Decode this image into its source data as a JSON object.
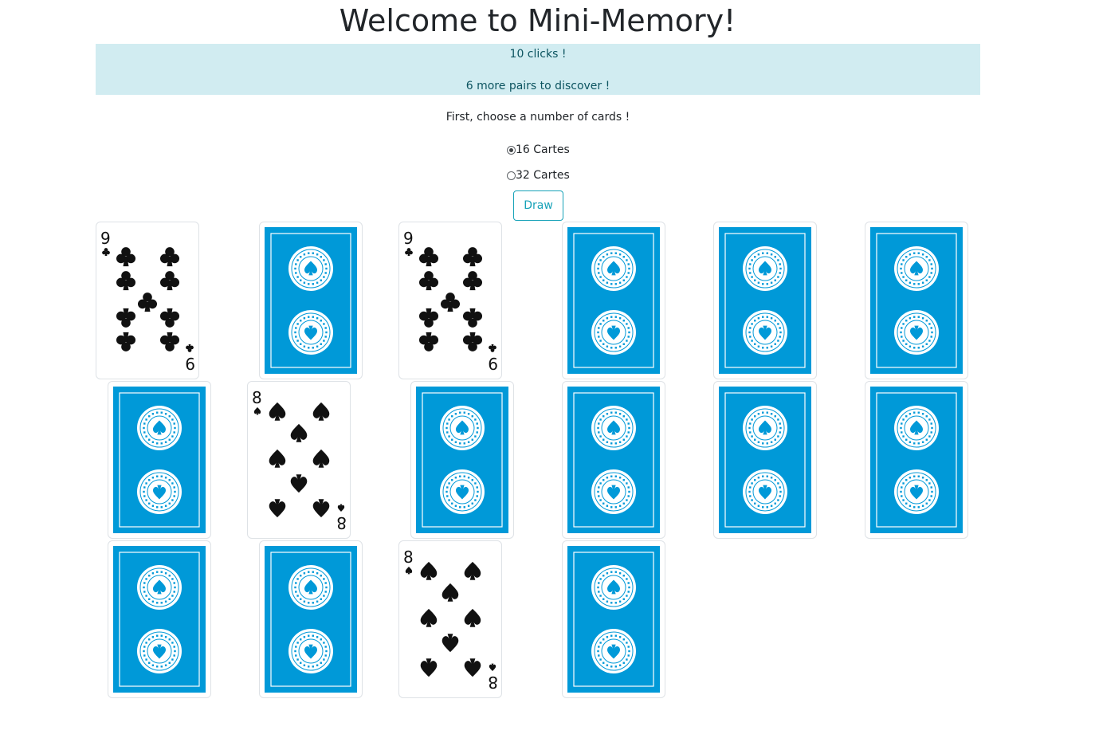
{
  "header": {
    "title": "Welcome to Mini-Memory!"
  },
  "status": {
    "clicks": "10 clicks !",
    "pairs": "6 more pairs to discover !"
  },
  "setup": {
    "instruction": "First, choose a number of cards !",
    "options": [
      {
        "label": "16 Cartes",
        "selected": true
      },
      {
        "label": "32 Cartes",
        "selected": false
      }
    ],
    "draw_label": "Draw"
  },
  "colors": {
    "card_back": "#0099d8",
    "alert_bg": "#d1ecf1",
    "alert_text": "#0c5460",
    "button": "#17a2b8"
  },
  "cards": [
    {
      "state": "face-up",
      "rank": "9",
      "suit": "clubs"
    },
    {
      "state": "face-down"
    },
    {
      "state": "face-up",
      "rank": "9",
      "suit": "clubs"
    },
    {
      "state": "face-down"
    },
    {
      "state": "face-down"
    },
    {
      "state": "face-down"
    },
    {
      "state": "face-down"
    },
    {
      "state": "face-up",
      "rank": "8",
      "suit": "spades"
    },
    {
      "state": "face-down"
    },
    {
      "state": "face-down"
    },
    {
      "state": "face-down"
    },
    {
      "state": "face-down"
    },
    {
      "state": "face-down"
    },
    {
      "state": "face-down"
    },
    {
      "state": "face-up",
      "rank": "8",
      "suit": "spades"
    },
    {
      "state": "face-down"
    }
  ]
}
